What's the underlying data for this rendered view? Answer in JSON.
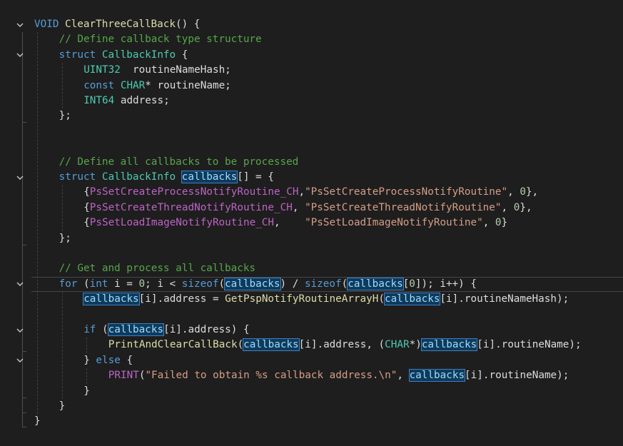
{
  "editor": {
    "lines": [
      {
        "fold": "down",
        "indent": 0,
        "tokens": [
          [
            "kw",
            "VOID"
          ],
          [
            "df",
            " "
          ],
          [
            "fn",
            "ClearThreeCallBack"
          ],
          [
            "df",
            "() {"
          ]
        ]
      },
      {
        "fold": "",
        "indent": 1,
        "tokens": [
          [
            "cm",
            "// Define callback type structure"
          ]
        ]
      },
      {
        "fold": "down",
        "indent": 1,
        "tokens": [
          [
            "kw",
            "struct"
          ],
          [
            "df",
            " "
          ],
          [
            "ty",
            "CallbackInfo"
          ],
          [
            "df",
            " {"
          ]
        ]
      },
      {
        "fold": "",
        "indent": 2,
        "tokens": [
          [
            "ty",
            "UINT32"
          ],
          [
            "df",
            "  routineNameHash;"
          ]
        ]
      },
      {
        "fold": "",
        "indent": 2,
        "tokens": [
          [
            "kw",
            "const"
          ],
          [
            "df",
            " "
          ],
          [
            "ty",
            "CHAR"
          ],
          [
            "df",
            "* routineName;"
          ]
        ]
      },
      {
        "fold": "",
        "indent": 2,
        "tokens": [
          [
            "ty",
            "INT64"
          ],
          [
            "df",
            " address;"
          ]
        ]
      },
      {
        "fold": "",
        "indent": 1,
        "tokens": [
          [
            "df",
            "};"
          ]
        ]
      },
      {
        "fold": "",
        "indent": 0,
        "tokens": []
      },
      {
        "fold": "",
        "indent": 0,
        "tokens": []
      },
      {
        "fold": "",
        "indent": 1,
        "tokens": [
          [
            "cm",
            "// Define all callbacks to be processed"
          ]
        ]
      },
      {
        "fold": "down",
        "indent": 1,
        "tokens": [
          [
            "kw",
            "struct"
          ],
          [
            "df",
            " "
          ],
          [
            "ty",
            "CallbackInfo"
          ],
          [
            "df",
            " "
          ],
          [
            "hl",
            "callbacks"
          ],
          [
            "df",
            "[] = {"
          ]
        ]
      },
      {
        "fold": "",
        "indent": 2,
        "tokens": [
          [
            "df",
            "{"
          ],
          [
            "mc",
            "PsSetCreateProcessNotifyRoutine_CH"
          ],
          [
            "df",
            ","
          ],
          [
            "st",
            "\"PsSetCreateProcessNotifyRoutine\""
          ],
          [
            "df",
            ", "
          ],
          [
            "nm",
            "0"
          ],
          [
            "df",
            "},"
          ]
        ]
      },
      {
        "fold": "",
        "indent": 2,
        "tokens": [
          [
            "df",
            "{"
          ],
          [
            "mc",
            "PsSetCreateThreadNotifyRoutine_CH"
          ],
          [
            "df",
            ", "
          ],
          [
            "st",
            "\"PsSetCreateThreadNotifyRoutine\""
          ],
          [
            "df",
            ", "
          ],
          [
            "nm",
            "0"
          ],
          [
            "df",
            "},"
          ]
        ]
      },
      {
        "fold": "",
        "indent": 2,
        "tokens": [
          [
            "df",
            "{"
          ],
          [
            "mc",
            "PsSetLoadImageNotifyRoutine_CH"
          ],
          [
            "df",
            ",    "
          ],
          [
            "st",
            "\"PsSetLoadImageNotifyRoutine\""
          ],
          [
            "df",
            ", "
          ],
          [
            "nm",
            "0"
          ],
          [
            "df",
            "}"
          ]
        ]
      },
      {
        "fold": "",
        "indent": 1,
        "tokens": [
          [
            "df",
            "};"
          ]
        ]
      },
      {
        "fold": "",
        "indent": 0,
        "tokens": []
      },
      {
        "fold": "",
        "indent": 1,
        "tokens": [
          [
            "cm",
            "// Get and process all callbacks"
          ]
        ]
      },
      {
        "fold": "down",
        "indent": 1,
        "current": true,
        "tokens": [
          [
            "kw",
            "for"
          ],
          [
            "df",
            " ("
          ],
          [
            "kw",
            "int"
          ],
          [
            "df",
            " i = "
          ],
          [
            "nm",
            "0"
          ],
          [
            "df",
            "; i < "
          ],
          [
            "kw",
            "sizeof"
          ],
          [
            "df",
            "("
          ],
          [
            "hl",
            "callbacks"
          ],
          [
            "df",
            ") / "
          ],
          [
            "kw",
            "sizeof"
          ],
          [
            "df",
            "("
          ],
          [
            "hl",
            "callbacks"
          ],
          [
            "df",
            "["
          ],
          [
            "nm",
            "0"
          ],
          [
            "df",
            "]); i++) {"
          ]
        ]
      },
      {
        "fold": "",
        "indent": 2,
        "tokens": [
          [
            "hl",
            "callbacks"
          ],
          [
            "df",
            "[i].address = "
          ],
          [
            "fn",
            "GetPspNotifyRoutineArrayH"
          ],
          [
            "df",
            "("
          ],
          [
            "hl",
            "callbacks"
          ],
          [
            "df",
            "[i].routineNameHash);"
          ]
        ]
      },
      {
        "fold": "",
        "indent": 0,
        "tokens": []
      },
      {
        "fold": "down",
        "indent": 2,
        "tokens": [
          [
            "kw",
            "if"
          ],
          [
            "df",
            " ("
          ],
          [
            "hl",
            "callbacks"
          ],
          [
            "df",
            "[i].address) {"
          ]
        ]
      },
      {
        "fold": "",
        "indent": 3,
        "tokens": [
          [
            "fn",
            "PrintAndClearCallBack"
          ],
          [
            "df",
            "("
          ],
          [
            "hl",
            "callbacks"
          ],
          [
            "df",
            "[i].address, ("
          ],
          [
            "ty",
            "CHAR"
          ],
          [
            "df",
            "*)"
          ],
          [
            "hl",
            "callbacks"
          ],
          [
            "df",
            "[i].routineName);"
          ]
        ]
      },
      {
        "fold": "down",
        "indent": 2,
        "tokens": [
          [
            "df",
            "} "
          ],
          [
            "kw",
            "else"
          ],
          [
            "df",
            " {"
          ]
        ]
      },
      {
        "fold": "",
        "indent": 3,
        "tokens": [
          [
            "mc",
            "PRINT"
          ],
          [
            "df",
            "("
          ],
          [
            "st",
            "\"Failed to obtain %s callback address.\\n\""
          ],
          [
            "df",
            ", "
          ],
          [
            "hl",
            "callbacks"
          ],
          [
            "df",
            "[i].routineName);"
          ]
        ]
      },
      {
        "fold": "",
        "indent": 2,
        "tokens": [
          [
            "df",
            "}"
          ]
        ]
      },
      {
        "fold": "",
        "indent": 1,
        "tokens": [
          [
            "df",
            "}"
          ]
        ]
      },
      {
        "fold": "",
        "indent": 0,
        "tokens": [
          [
            "df",
            "}"
          ]
        ]
      }
    ]
  }
}
